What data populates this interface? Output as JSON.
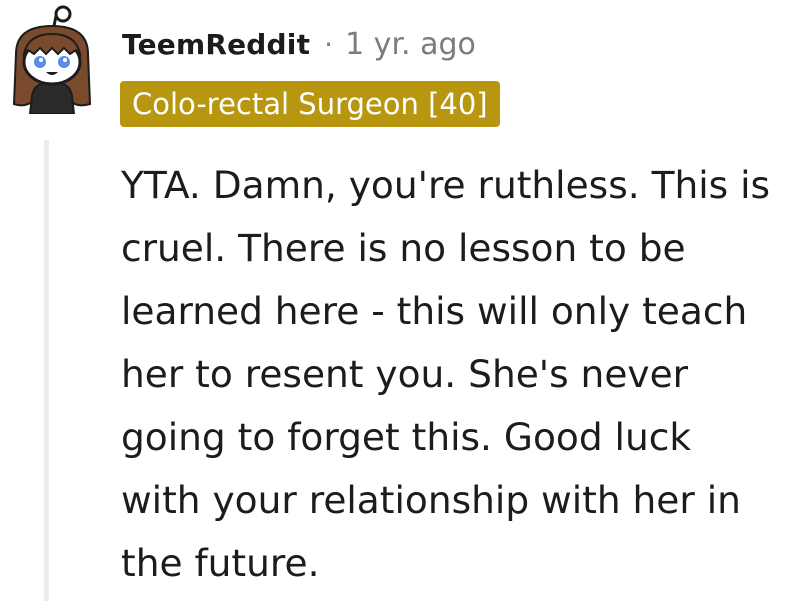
{
  "comment": {
    "author": {
      "username": "TeemReddit",
      "avatar_icon": "snoo-avatar-icon"
    },
    "separator": "·",
    "timestamp": "1 yr. ago",
    "flair": {
      "text": "Colo-rectal Surgeon [40]",
      "color": "#b8960f"
    },
    "body": "YTA. Damn, you're ruthless. This is cruel. There is no lesson to be learned here - this will only teach her to resent you. She's never going to forget this. Good luck with your relationship with her in the future."
  }
}
